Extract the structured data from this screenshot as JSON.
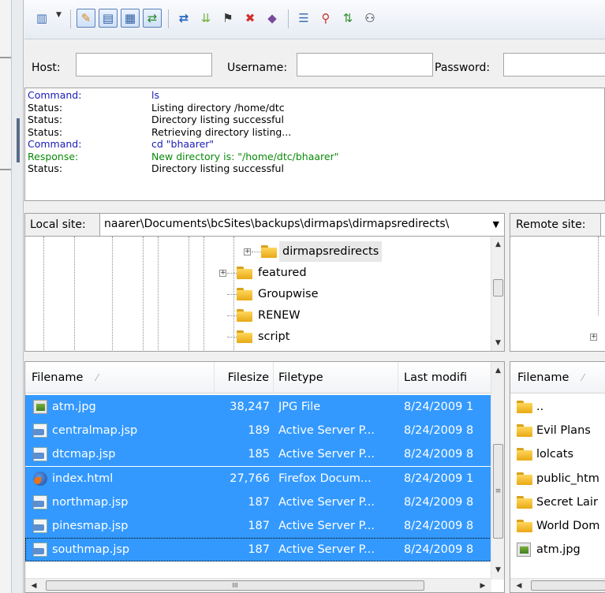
{
  "toolbar": {
    "icons": [
      "site-manager-icon",
      "dropdown-arrow-icon",
      "toggle-log-icon",
      "toggle-local-tree-icon",
      "toggle-remote-tree-icon",
      "toggle-queue-icon",
      "refresh-icon",
      "process-queue-icon",
      "cancel-icon",
      "disconnect-icon",
      "reconnect-icon",
      "directory-listing-filters-icon",
      "compare-icon",
      "sync-browsing-icon",
      "search-icon"
    ]
  },
  "quickconnect": {
    "host_label": "Host:",
    "username_label": "Username:",
    "password_label": "Password:",
    "host_value": "",
    "username_value": "",
    "password_value": ""
  },
  "log": [
    {
      "type": "Command:",
      "msg": "ls",
      "color": "blue"
    },
    {
      "type": "Status:",
      "msg": "Listing directory /home/dtc",
      "color": "black"
    },
    {
      "type": "Status:",
      "msg": "Directory listing successful",
      "color": "black"
    },
    {
      "type": "Status:",
      "msg": "Retrieving directory listing...",
      "color": "black"
    },
    {
      "type": "Command:",
      "msg": "cd \"bhaarer\"",
      "color": "blue"
    },
    {
      "type": "Response:",
      "msg": "New directory is: \"/home/dtc/bhaarer\"",
      "color": "green"
    },
    {
      "type": "Status:",
      "msg": "Directory listing successful",
      "color": "black"
    }
  ],
  "local_site": {
    "label": "Local site:",
    "path": "naarer\\Documents\\bcSites\\backups\\dirmaps\\dirmapsredirects\\"
  },
  "remote_site": {
    "label": "Remote site:"
  },
  "local_tree": [
    {
      "name": "dirmapsredirects",
      "expander": "+",
      "selected": true
    },
    {
      "name": "featured",
      "expander": "+",
      "selected": false
    },
    {
      "name": "Groupwise",
      "expander": "",
      "selected": false
    },
    {
      "name": "RENEW",
      "expander": "",
      "selected": false
    },
    {
      "name": "script",
      "expander": "",
      "selected": false
    }
  ],
  "local_files": {
    "columns": [
      "Filename",
      "Filesize",
      "Filetype",
      "Last modifi"
    ],
    "sort_indicator": "⁄",
    "rows": [
      {
        "name": "atm.jpg",
        "size": "38,247",
        "type": "JPG File",
        "modified": "8/24/2009 1",
        "icon": "jpg-file-icon"
      },
      {
        "name": "centralmap.jsp",
        "size": "189",
        "type": "Active Server P...",
        "modified": "8/24/2009 8",
        "icon": "jsp-file-icon"
      },
      {
        "name": "dtcmap.jsp",
        "size": "185",
        "type": "Active Server P...",
        "modified": "8/24/2009 8",
        "icon": "jsp-file-icon"
      },
      {
        "name": "index.html",
        "size": "27,766",
        "type": "Firefox Docum...",
        "modified": "8/24/2009 1",
        "icon": "firefox-html-icon"
      },
      {
        "name": "northmap.jsp",
        "size": "187",
        "type": "Active Server P...",
        "modified": "8/24/2009 8",
        "icon": "jsp-file-icon"
      },
      {
        "name": "pinesmap.jsp",
        "size": "187",
        "type": "Active Server P...",
        "modified": "8/24/2009 8",
        "icon": "jsp-file-icon"
      },
      {
        "name": "southmap.jsp",
        "size": "187",
        "type": "Active Server P...",
        "modified": "8/24/2009 8",
        "icon": "jsp-file-icon"
      }
    ]
  },
  "remote_files": {
    "columns": [
      "Filename"
    ],
    "sort_indicator": "⁄",
    "rows": [
      {
        "name": "..",
        "icon": "folder-icon"
      },
      {
        "name": "Evil Plans",
        "icon": "folder-icon"
      },
      {
        "name": "lolcats",
        "icon": "folder-icon"
      },
      {
        "name": "public_htm",
        "icon": "folder-icon"
      },
      {
        "name": "Secret Lair",
        "icon": "folder-icon"
      },
      {
        "name": "World Dom",
        "icon": "folder-icon"
      },
      {
        "name": "atm.jpg",
        "icon": "jpg-file-icon"
      }
    ]
  },
  "scroll": {
    "hthumb_glyph": "III"
  },
  "colors": {
    "selection": "#3399ff",
    "command_blue": "#1a1ab8",
    "response_green": "#0a8a0a"
  }
}
